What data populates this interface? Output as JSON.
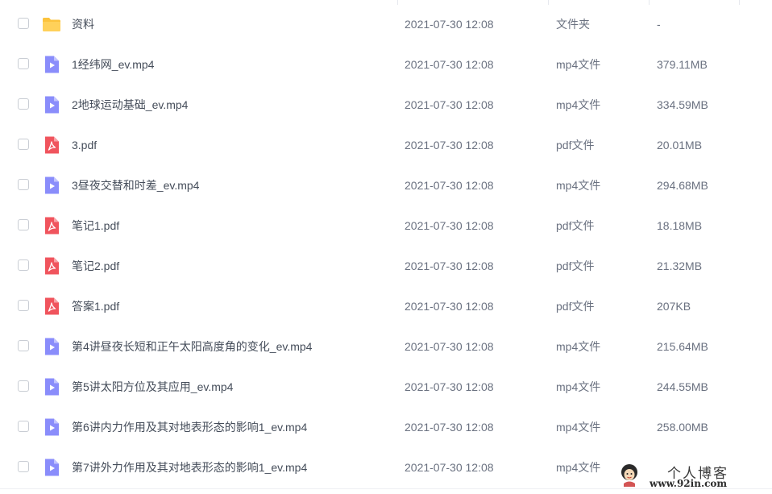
{
  "files": [
    {
      "name": "资料",
      "date": "2021-07-30 12:08",
      "type": "文件夹",
      "size": "-",
      "icon": "folder-icon"
    },
    {
      "name": "1经纬网_ev.mp4",
      "date": "2021-07-30 12:08",
      "type": "mp4文件",
      "size": "379.11MB",
      "icon": "video-icon"
    },
    {
      "name": "2地球运动基础_ev.mp4",
      "date": "2021-07-30 12:08",
      "type": "mp4文件",
      "size": "334.59MB",
      "icon": "video-icon"
    },
    {
      "name": "3.pdf",
      "date": "2021-07-30 12:08",
      "type": "pdf文件",
      "size": "20.01MB",
      "icon": "pdf-icon"
    },
    {
      "name": "3昼夜交替和时差_ev.mp4",
      "date": "2021-07-30 12:08",
      "type": "mp4文件",
      "size": "294.68MB",
      "icon": "video-icon"
    },
    {
      "name": "笔记1.pdf",
      "date": "2021-07-30 12:08",
      "type": "pdf文件",
      "size": "18.18MB",
      "icon": "pdf-icon"
    },
    {
      "name": "笔记2.pdf",
      "date": "2021-07-30 12:08",
      "type": "pdf文件",
      "size": "21.32MB",
      "icon": "pdf-icon"
    },
    {
      "name": "答案1.pdf",
      "date": "2021-07-30 12:08",
      "type": "pdf文件",
      "size": "207KB",
      "icon": "pdf-icon"
    },
    {
      "name": "第4讲昼夜长短和正午太阳高度角的变化_ev.mp4",
      "date": "2021-07-30 12:08",
      "type": "mp4文件",
      "size": "215.64MB",
      "icon": "video-icon"
    },
    {
      "name": "第5讲太阳方位及其应用_ev.mp4",
      "date": "2021-07-30 12:08",
      "type": "mp4文件",
      "size": "244.55MB",
      "icon": "video-icon"
    },
    {
      "name": "第6讲内力作用及其对地表形态的影响1_ev.mp4",
      "date": "2021-07-30 12:08",
      "type": "mp4文件",
      "size": "258.00MB",
      "icon": "video-icon"
    },
    {
      "name": "第7讲外力作用及其对地表形态的影响1_ev.mp4",
      "date": "2021-07-30 12:08",
      "type": "mp4文件",
      "size": "",
      "icon": "video-icon"
    }
  ],
  "watermark": {
    "title": "个人博客",
    "url": "www.92in.com"
  },
  "colors": {
    "folder": "#fcc33d",
    "video": "#8a8dfb",
    "pdf": "#f0545d"
  }
}
